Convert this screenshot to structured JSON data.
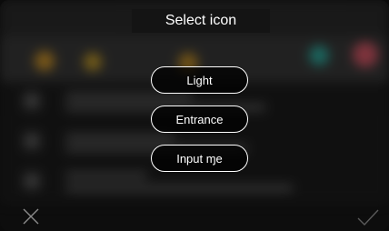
{
  "dialog": {
    "title": "Select icon",
    "options": [
      {
        "label": "Light"
      },
      {
        "label": "Entrance"
      },
      {
        "label": "Input ɱe"
      }
    ]
  },
  "icons": {
    "close": "close-icon",
    "confirm": "checkmark-icon"
  },
  "colors": {
    "background": "#141414",
    "text": "#ffffff",
    "accent_teal": "#2fb3a6",
    "accent_red": "#e05a6a",
    "accent_amber": "#d69a2a",
    "icon_muted": "#7a7a7a"
  }
}
